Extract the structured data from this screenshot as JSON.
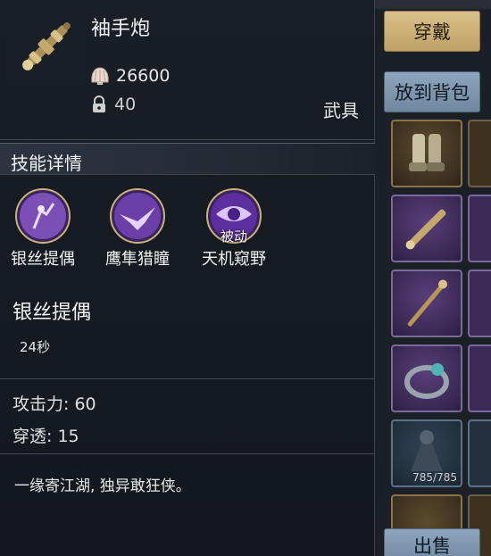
{
  "item": {
    "name": "袖手炮",
    "price": "26600",
    "lock_value": "40",
    "type": "武具"
  },
  "skills": {
    "section_title": "技能详情",
    "list": [
      {
        "label": "银丝提偶",
        "icon": "puppet-skill-icon",
        "color": "#7b4fb5"
      },
      {
        "label": "鹰隼猎瞳",
        "icon": "falcon-skill-icon",
        "color": "#6a3fa8"
      },
      {
        "label": "天机窥野",
        "icon": "eye-skill-icon",
        "color": "#5d2f9e",
        "tag": "被动"
      }
    ],
    "selected_name": "银丝提偶",
    "selected_cooldown": "24秒"
  },
  "attributes": {
    "attack": "攻击力: 60",
    "penetration": "穿透: 15"
  },
  "flavor_text": "一缘寄江湖, 独异敢狂侠。",
  "side": {
    "equip_label": "穿戴",
    "bag_label": "放到背包",
    "sell_label": "出售",
    "slot_count": "785/785"
  },
  "colors": {
    "equip_button": "#d9c08a",
    "secondary_button": "#8ea6bd"
  }
}
